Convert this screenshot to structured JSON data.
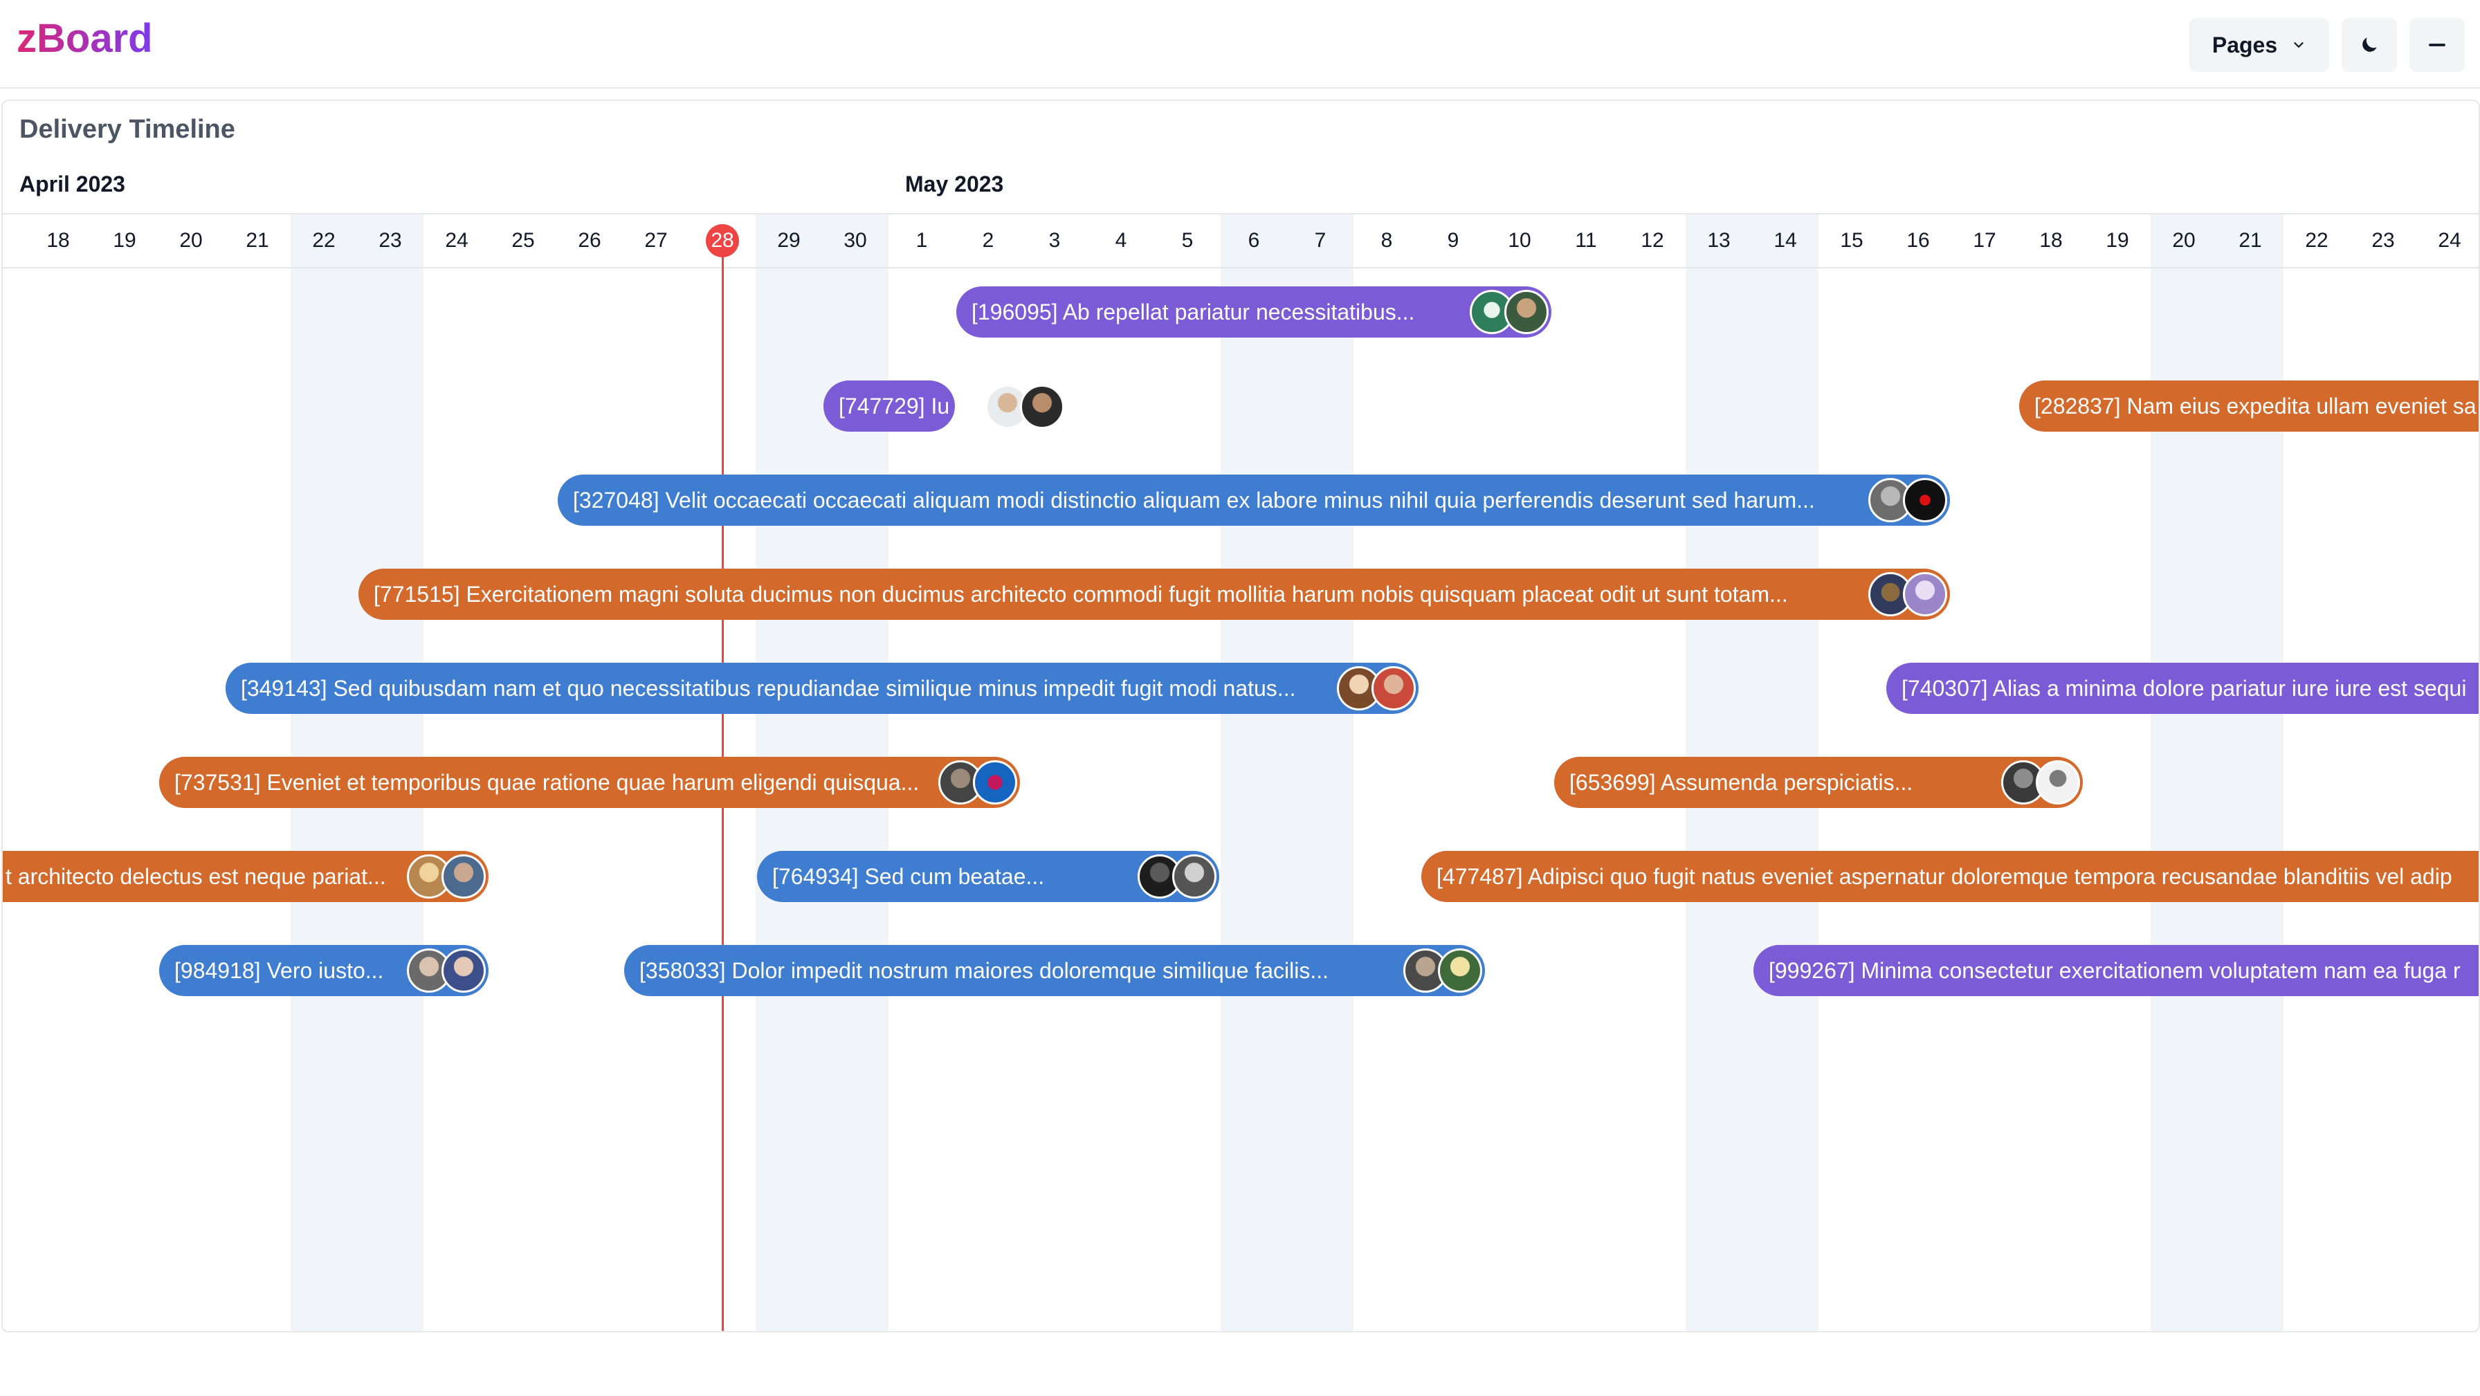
{
  "app": {
    "logo": "zBoard"
  },
  "header": {
    "pages_label": "Pages",
    "theme_icon": "moon-icon",
    "minimize_icon": "minus-icon"
  },
  "timeline": {
    "title": "Delivery Timeline",
    "months": [
      {
        "label": "April 2023"
      },
      {
        "label": "May 2023"
      }
    ],
    "days": [
      "18",
      "19",
      "20",
      "21",
      "22",
      "23",
      "24",
      "25",
      "26",
      "27",
      "28",
      "29",
      "30",
      "1",
      "2",
      "3",
      "4",
      "5",
      "6",
      "7",
      "8",
      "9",
      "10",
      "11",
      "12",
      "13",
      "14",
      "15",
      "16",
      "17",
      "18",
      "19",
      "20",
      "21",
      "22",
      "23",
      "24"
    ],
    "today": "28",
    "items": [
      {
        "label": "[196095] Ab repellat pariatur necessitatibus...",
        "color": "purple"
      },
      {
        "label": "[747729] Iu",
        "color": "purple"
      },
      {
        "label": "[282837] Nam eius expedita ullam eveniet sa",
        "color": "orange"
      },
      {
        "label": "[327048] Velit occaecati occaecati aliquam modi distinctio aliquam ex labore minus nihil quia perferendis deserunt sed harum...",
        "color": "blue"
      },
      {
        "label": "[771515] Exercitationem magni soluta ducimus non ducimus architecto commodi fugit mollitia harum nobis quisquam placeat odit ut sunt totam...",
        "color": "orange"
      },
      {
        "label": "[349143] Sed quibusdam nam et quo necessitatibus repudiandae similique minus impedit fugit modi natus...",
        "color": "blue"
      },
      {
        "label": "[740307] Alias a minima dolore pariatur iure iure est sequi",
        "color": "purple"
      },
      {
        "label": "[737531] Eveniet et temporibus quae ratione quae harum eligendi quisqua...",
        "color": "orange"
      },
      {
        "label": "[653699] Assumenda perspiciatis...",
        "color": "orange"
      },
      {
        "label": "t architecto delectus est neque pariat...",
        "color": "orange"
      },
      {
        "label": "[764934] Sed cum beatae...",
        "color": "blue"
      },
      {
        "label": "[477487] Adipisci quo fugit natus eveniet aspernatur doloremque tempora recusandae blanditiis vel adip",
        "color": "orange"
      },
      {
        "label": "[984918] Vero iusto...",
        "color": "blue"
      },
      {
        "label": "[358033] Dolor impedit nostrum maiores doloremque similique facilis...",
        "color": "blue"
      },
      {
        "label": "[999267] Minima consectetur exercitationem voluptatem nam ea fuga r",
        "color": "purple"
      }
    ]
  },
  "colors": {
    "purple": "#7c5cd6",
    "blue": "#3f7dd0",
    "orange": "#d4692c",
    "today": "#ef4444",
    "weekend": "#f1f4f8"
  }
}
